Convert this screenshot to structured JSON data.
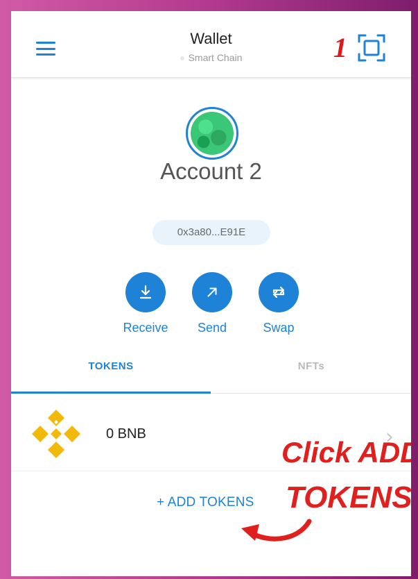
{
  "header": {
    "title": "Wallet",
    "network": "Smart Chain",
    "menu_icon": "hamburger-menu-icon",
    "scan_icon": "qr-scan-icon"
  },
  "account": {
    "name": "Account 2",
    "address": "0x3a80...E91E"
  },
  "actions": [
    {
      "label": "Receive",
      "icon": "download-icon"
    },
    {
      "label": "Send",
      "icon": "arrow-up-right-icon"
    },
    {
      "label": "Swap",
      "icon": "swap-icon"
    }
  ],
  "tabs": [
    {
      "label": "TOKENS",
      "active": true
    },
    {
      "label": "NFTs",
      "active": false
    }
  ],
  "tokens": [
    {
      "amount": "0 BNB",
      "icon": "bnb-logo-icon"
    }
  ],
  "add_tokens_label": "+ ADD TOKENS",
  "annotations": {
    "step_number": "1",
    "instruction_line1": "Click ADD",
    "instruction_line2": "TOKENS"
  },
  "colors": {
    "accent": "#1e82d6",
    "annotation_red": "#e0201e",
    "border_pink": "#c04a9c",
    "bnb_yellow": "#f0b90b"
  }
}
